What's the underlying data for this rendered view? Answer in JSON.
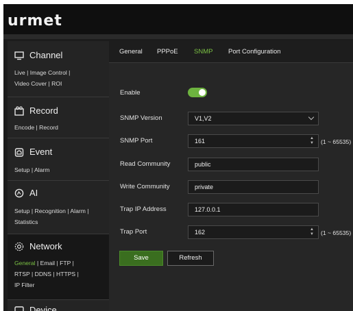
{
  "brand": {
    "logo": "urmet"
  },
  "sidebar": {
    "sections": [
      {
        "title": "Channel",
        "icon": "monitor-icon",
        "links": [
          "Live",
          "Image Control",
          "Video Cover",
          "ROI"
        ]
      },
      {
        "title": "Record",
        "icon": "record-icon",
        "links": [
          "Encode",
          "Record"
        ]
      },
      {
        "title": "Event",
        "icon": "alarm-icon",
        "links": [
          "Setup",
          "Alarm"
        ]
      },
      {
        "title": "AI",
        "icon": "ai-icon",
        "links": [
          "Setup",
          "Recognition",
          "Alarm",
          "Statistics"
        ]
      },
      {
        "title": "Network",
        "icon": "network-icon",
        "links": [
          "General",
          "Email",
          "FTP",
          "RTSP",
          "DDNS",
          "HTTPS",
          "IP Filter"
        ],
        "active_link": "General"
      },
      {
        "title": "Device",
        "icon": "device-icon",
        "links": []
      }
    ],
    "separator": "|"
  },
  "tabs": [
    {
      "label": "General"
    },
    {
      "label": "PPPoE"
    },
    {
      "label": "SNMP",
      "active": true
    },
    {
      "label": "Port Configuration"
    }
  ],
  "form": {
    "enable": {
      "label": "Enable",
      "value": true
    },
    "snmp_version": {
      "label": "SNMP Version",
      "value": "V1,V2"
    },
    "snmp_port": {
      "label": "SNMP Port",
      "value": "161",
      "range": "(1 ~ 65535)"
    },
    "read_community": {
      "label": "Read Community",
      "value": "public"
    },
    "write_community": {
      "label": "Write Community",
      "value": "private"
    },
    "trap_ip": {
      "label": "Trap IP Address",
      "value": "127.0.0.1"
    },
    "trap_port": {
      "label": "Trap Port",
      "value": "162",
      "range": "(1 ~ 65535)"
    }
  },
  "buttons": {
    "save": "Save",
    "refresh": "Refresh"
  },
  "colors": {
    "accent": "#7bc144",
    "toggle_on": "#6db33f",
    "save_bg": "#3a6e1f",
    "panel": "#262626",
    "sidebar": "#242424"
  }
}
